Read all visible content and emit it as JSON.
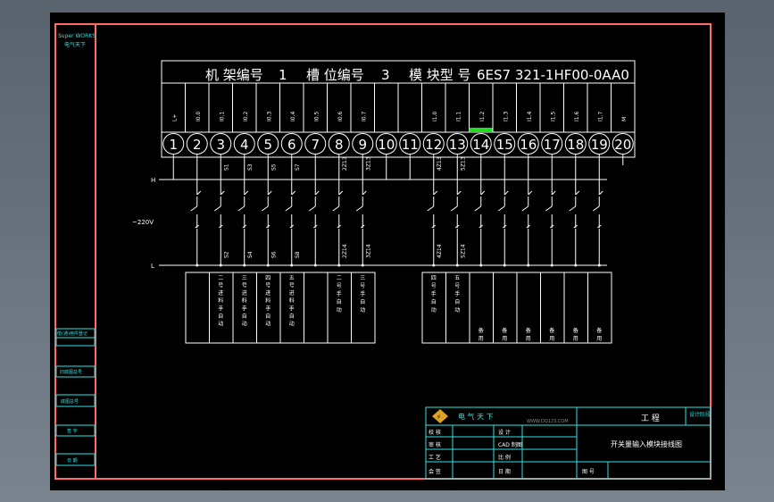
{
  "drawing": {
    "header": {
      "rack_label": "机 架编号",
      "rack_no": "1",
      "slot_label": "槽 位编号",
      "slot_no": "3",
      "module_label": "模 块型 号",
      "module_no": "6ES7 321-1HF00-0AA0"
    },
    "terminal_labels": [
      "L+",
      "I0.0",
      "I0.1",
      "I0.2",
      "I0.3",
      "I0.4",
      "I0.5",
      "I0.6",
      "I0.7",
      "",
      "",
      "I1.0",
      "I1.1",
      "I1.2",
      "I1.3",
      "I1.4",
      "I1.5",
      "I1.6",
      "I1.7",
      "M"
    ],
    "terminal_numbers": [
      "1",
      "2",
      "3",
      "4",
      "5",
      "6",
      "7",
      "8",
      "9",
      "10",
      "11",
      "12",
      "13",
      "14",
      "15",
      "16",
      "17",
      "18",
      "19",
      "20"
    ],
    "highlight_terminal": "I1.2",
    "highlight_color": "#22dd22",
    "rail_top_label": "H",
    "rail_bottom_label": "L",
    "voltage_label": "~220V",
    "wire_labels_top": [
      "S1",
      "S3",
      "S5",
      "S7",
      "2Z13",
      "3Z13",
      "4Z13",
      "5Z13"
    ],
    "wire_labels_bottom": [
      "S2",
      "S4",
      "S6",
      "S8",
      "2Z14",
      "3Z14",
      "4Z14",
      "5Z14"
    ],
    "description_boxes": [
      "二号进料手自动",
      "三号进料手自动",
      "四号进料手自动",
      "五号进料手自动",
      "二号手自动",
      "三号手自动",
      "四号手自动",
      "五号手自动",
      "备用",
      "备用",
      "备用",
      "备用",
      "备用",
      "备用"
    ],
    "title_block": {
      "company": "电 气 天 下",
      "website": "WWW.DQ123.COM",
      "project_label": "工 程",
      "stage_label": "设计阶段",
      "drawing_title": "开关量输入模块接线图",
      "rows_left": [
        "校 核",
        "审 核",
        "工 艺",
        "会 签"
      ],
      "rows_mid": [
        "设 计",
        "CAD 制图",
        "比 例",
        "日 期"
      ],
      "drawing_no_label": "图 号"
    },
    "left_margin": {
      "logo_line1": "Super WORKS",
      "logo_line2": "电气天下",
      "labels": [
        "借(通)用件登记",
        "旧底图总号",
        "底图总号",
        "签 字",
        "日 期"
      ]
    }
  }
}
